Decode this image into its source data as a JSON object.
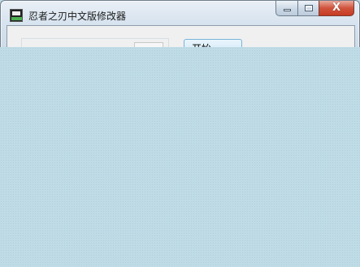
{
  "window": {
    "title": "忍者之刃中文版修改器",
    "app_icon": "game-trainer-app-icon"
  },
  "caption_buttons": {
    "minimize_icon": "minimize-icon",
    "maximize_icon": "maximize-icon",
    "close_glyph": "X"
  },
  "main": {
    "tab_label": "开始"
  },
  "colors": {
    "desktop_background": "#bfdce6",
    "close_button": "#c63a24",
    "tab_border": "#7ab3d8"
  }
}
